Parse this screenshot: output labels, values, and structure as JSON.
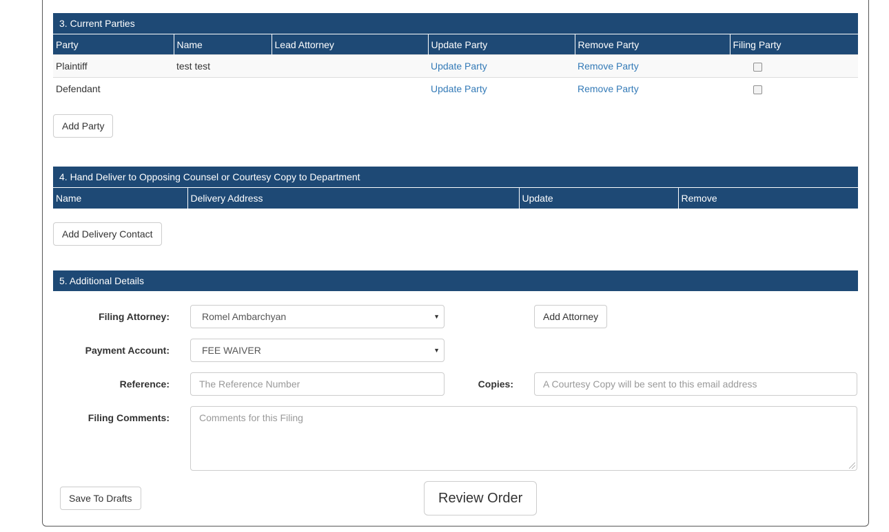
{
  "parties": {
    "title": "3. Current Parties",
    "columns": [
      "Party",
      "Name",
      "Lead Attorney",
      "Update Party",
      "Remove Party",
      "Filing Party"
    ],
    "rows": [
      {
        "party": "Plaintiff",
        "name": "test test",
        "lead_attorney": "",
        "update": "Update Party",
        "remove": "Remove Party",
        "filing_party_checked": false
      },
      {
        "party": "Defendant",
        "name": "",
        "lead_attorney": "",
        "update": "Update Party",
        "remove": "Remove Party",
        "filing_party_checked": false
      }
    ],
    "add_button": "Add Party"
  },
  "delivery": {
    "title": "4. Hand Deliver to Opposing Counsel or Courtesy Copy to Department",
    "columns": [
      "Name",
      "Delivery Address",
      "Update",
      "Remove"
    ],
    "add_button": "Add Delivery Contact"
  },
  "details": {
    "title": "5. Additional Details",
    "filing_attorney_label": "Filing Attorney:",
    "filing_attorney_value": "Romel Ambarchyan",
    "add_attorney_button": "Add Attorney",
    "payment_account_label": "Payment Account:",
    "payment_account_value": "FEE WAIVER",
    "reference_label": "Reference:",
    "reference_placeholder": "The Reference Number",
    "copies_label": "Copies:",
    "copies_placeholder": "A Courtesy Copy will be sent to this email address",
    "comments_label": "Filing Comments:",
    "comments_placeholder": "Comments for this Filing"
  },
  "actions": {
    "save_drafts": "Save To Drafts",
    "review_order": "Review Order"
  },
  "colors": {
    "header_bg": "#1e4975",
    "link": "#337ab7"
  }
}
